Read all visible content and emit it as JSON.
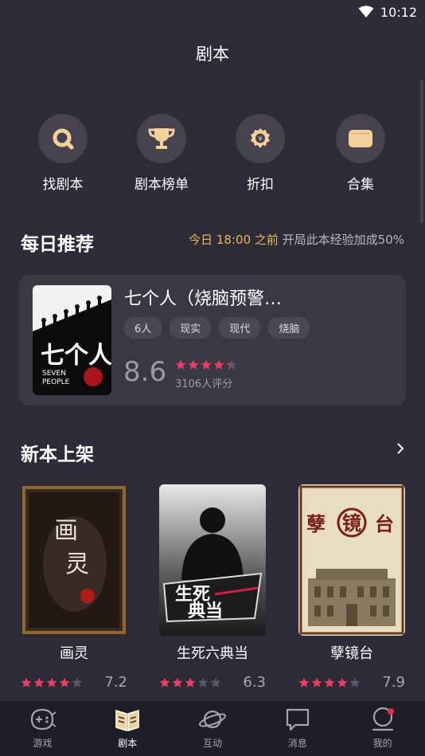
{
  "status_bar": {
    "time": "10:12"
  },
  "header": {
    "title": "剧本"
  },
  "quick_actions": [
    {
      "label": "找剧本",
      "icon": "search-icon"
    },
    {
      "label": "剧本榜单",
      "icon": "trophy-icon"
    },
    {
      "label": "折扣",
      "icon": "discount-icon"
    },
    {
      "label": "合集",
      "icon": "collection-icon"
    }
  ],
  "daily": {
    "title": "每日推荐",
    "note_highlight": "今日 18:00 之前",
    "note_rest": " 开局此本经验加成50%",
    "feature": {
      "title": "七个人（烧脑预警…",
      "tags": [
        "6人",
        "现实",
        "现代",
        "烧脑"
      ],
      "score": "8.6",
      "rating_fraction": 0.86,
      "rating_count": "3106人评分",
      "cover": {
        "big_text": "七个人",
        "en_text_1": "SEVEN",
        "en_text_2": "PEOPLE"
      }
    }
  },
  "new_releases": {
    "title": "新本上架",
    "books": [
      {
        "title": "画灵",
        "score": "7.2",
        "stars_filled": 4,
        "cover_text": "画灵"
      },
      {
        "title": "生死六典当",
        "score": "6.3",
        "stars_filled": 3,
        "cover_text": "生死典当"
      },
      {
        "title": "孽镜台",
        "score": "7.9",
        "stars_filled": 4,
        "cover_text": "孽镜台"
      }
    ]
  },
  "tabbar": [
    {
      "label": "游戏",
      "icon": "gamepad-icon",
      "active": false
    },
    {
      "label": "剧本",
      "icon": "book-icon",
      "active": true
    },
    {
      "label": "互动",
      "icon": "planet-icon",
      "active": false
    },
    {
      "label": "消息",
      "icon": "message-icon",
      "active": false
    },
    {
      "label": "我的",
      "icon": "profile-icon",
      "active": false
    }
  ],
  "colors": {
    "accent": "#e8b75a",
    "star": "#e83e66",
    "background": "#2d2b37"
  }
}
